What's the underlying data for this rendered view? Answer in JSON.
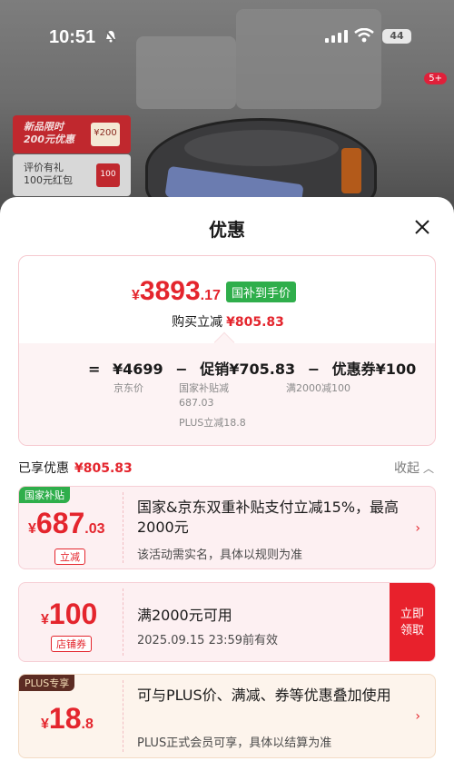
{
  "status_bar": {
    "time": "10:51",
    "battery": "44"
  },
  "background": {
    "nav_badge": "5+",
    "promo1": {
      "line1": "新品限时",
      "line2": "200元优惠",
      "chip": "¥200"
    },
    "promo2": {
      "line1": "评价有礼",
      "line2": "100元红包",
      "chip": "100"
    }
  },
  "sheet": {
    "title": "优惠",
    "summary": {
      "final_price_symbol": "¥",
      "final_price_int": "3893",
      "final_price_dec": ".17",
      "price_tag": "国补到手价",
      "instant_label": "购买立减",
      "instant_amount": "¥805.83",
      "formula": {
        "eq": "=",
        "jd_price": "¥4699",
        "minus1": "−",
        "promo": "促销¥705.83",
        "minus2": "−",
        "coupon": "优惠券¥100"
      },
      "sub": {
        "jd_price_label": "京东价",
        "promo_detail1": "国家补贴减687.03",
        "promo_detail2": "PLUS立减18.8",
        "coupon_detail": "满2000减100"
      }
    },
    "enjoyed": {
      "label": "已享优惠",
      "amount": "¥805.83",
      "collapse": "收起",
      "collapse_icon": "chevron-up-icon"
    },
    "cards": [
      {
        "tag": "国家补贴",
        "amount_symbol": "¥",
        "amount_int": "687",
        "amount_dec": ".03",
        "pill": "立减",
        "title": "国家&京东双重补贴支付立减15%，最高2000元",
        "subtitle": "该活动需实名，具体以规则为准"
      },
      {
        "amount_symbol": "¥",
        "amount_int": "100",
        "pill": "店铺券",
        "title": "满2000元可用",
        "subtitle": "2025.09.15 23:59前有效",
        "claim_line1": "立即",
        "claim_line2": "领取"
      },
      {
        "tag": "PLUS专享",
        "amount_symbol": "¥",
        "amount_int": "18",
        "amount_dec": ".8",
        "title": "可与PLUS价、满减、券等优惠叠加使用",
        "subtitle": "PLUS正式会员可享，具体以结算为准"
      }
    ]
  },
  "colors": {
    "accent_red": "#e4252d",
    "subsidy_green": "#2fae4b",
    "plus_brown": "#5c2c23"
  }
}
